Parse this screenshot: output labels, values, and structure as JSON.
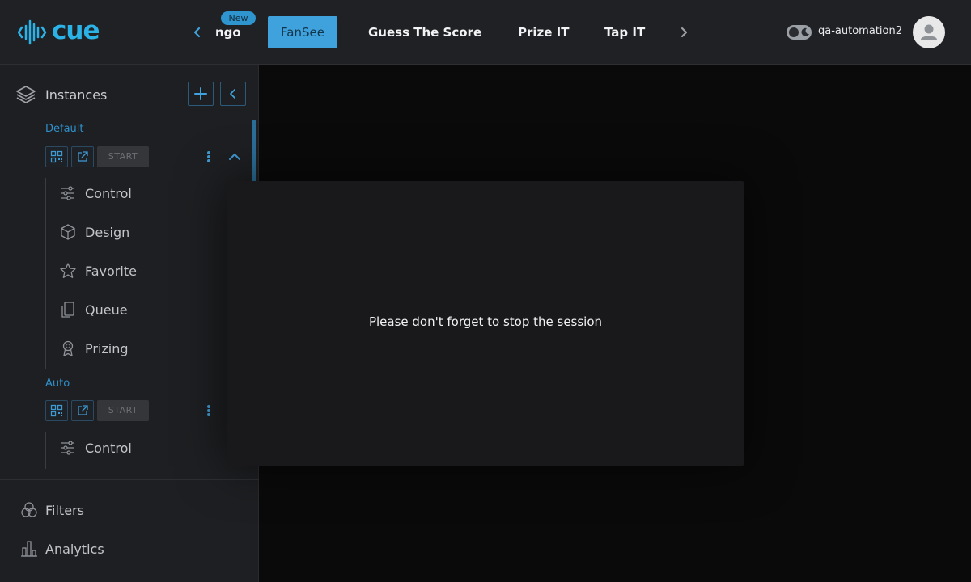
{
  "brand": {
    "logo_text": "cue"
  },
  "header": {
    "tabs": [
      {
        "label": "ngo",
        "badge": "New"
      },
      {
        "label": "FanSee",
        "active": true
      },
      {
        "label": "Guess The Score"
      },
      {
        "label": "Prize IT"
      },
      {
        "label": "Tap IT"
      }
    ],
    "username": "qa-automation2",
    "accent_color": "#3fa2dc"
  },
  "sidebar": {
    "title": "Instances",
    "groups": [
      {
        "label": "Default",
        "start_label": "START",
        "items": [
          {
            "label": "Control",
            "icon": "sliders-icon"
          },
          {
            "label": "Design",
            "icon": "cube-icon"
          },
          {
            "label": "Favorite",
            "icon": "star-icon"
          },
          {
            "label": "Queue",
            "icon": "queue-icon"
          },
          {
            "label": "Prizing",
            "icon": "award-icon"
          }
        ]
      },
      {
        "label": "Auto",
        "start_label": "START",
        "items": [
          {
            "label": "Control",
            "icon": "sliders-icon"
          }
        ]
      }
    ],
    "bottom": [
      {
        "label": "Filters",
        "icon": "filters-icon"
      },
      {
        "label": "Analytics",
        "icon": "analytics-icon"
      }
    ]
  },
  "modal": {
    "message": "Please don't forget to stop the session"
  }
}
